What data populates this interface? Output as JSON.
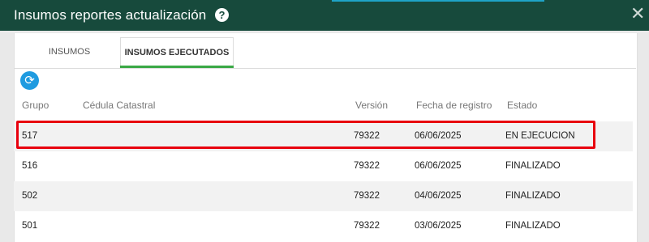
{
  "window": {
    "title": "Insumos reportes actualización",
    "help_icon": "?",
    "close_icon": "✕"
  },
  "tabs": [
    {
      "label": "INSUMOS",
      "active": false
    },
    {
      "label": "INSUMOS EJECUTADOS",
      "active": true
    }
  ],
  "toolbar": {
    "refresh_icon": "⟳"
  },
  "table": {
    "headers": {
      "grupo": "Grupo",
      "cedula": "Cédula Catastral",
      "version": "Versión",
      "fecha": "Fecha de registro",
      "estado": "Estado"
    },
    "rows": [
      {
        "grupo": "517",
        "cedula": "",
        "version": "79322",
        "fecha": "06/06/2025",
        "estado": "EN EJECUCION"
      },
      {
        "grupo": "516",
        "cedula": "",
        "version": "79322",
        "fecha": "06/06/2025",
        "estado": "FINALIZADO"
      },
      {
        "grupo": "502",
        "cedula": "",
        "version": "79322",
        "fecha": "04/06/2025",
        "estado": "FINALIZADO"
      },
      {
        "grupo": "501",
        "cedula": "",
        "version": "79322",
        "fecha": "03/06/2025",
        "estado": "FINALIZADO"
      }
    ]
  },
  "colors": {
    "titlebar": "#174a3c",
    "active_tab_underline": "#3aa845",
    "refresh": "#1f9be0",
    "highlight": "#e8000e"
  }
}
